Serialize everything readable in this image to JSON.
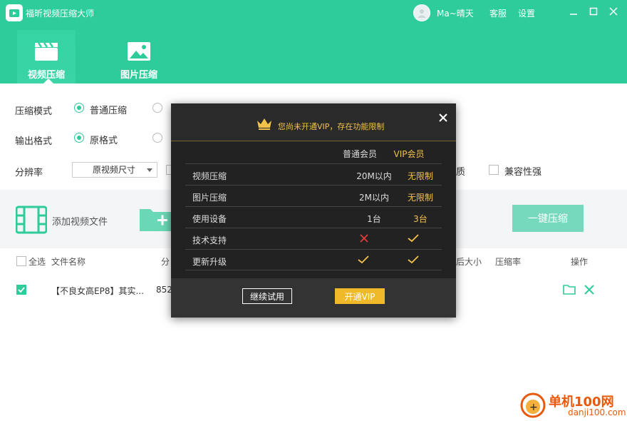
{
  "app": {
    "title": "福昕视频压缩大师"
  },
  "user": {
    "name": "Ma~晴天"
  },
  "header": {
    "service": "客服",
    "settings": "设置"
  },
  "tabs": [
    {
      "label": "视频压缩",
      "active": true
    },
    {
      "label": "图片压缩",
      "active": false
    }
  ],
  "options": {
    "mode_label": "压缩模式",
    "mode_selected": "普通压缩",
    "format_label": "输出格式",
    "format_selected": "原格式",
    "resolution_label": "分辨率",
    "resolution_value": "原视频尺寸",
    "right_option_1": "质",
    "compat_label": "兼容性强"
  },
  "toolbar": {
    "add_video_label": "添加视频文件",
    "compress_button": "一键压缩"
  },
  "table": {
    "headers": {
      "select_all": "全选",
      "file_name": "文件名称",
      "resolution_partial": "分",
      "size_after_partial": "后大小",
      "ratio": "压缩率",
      "action": "操作"
    },
    "rows": [
      {
        "checked": true,
        "name": "【不良女高EP8】其实...",
        "size_partial": "852"
      }
    ]
  },
  "dialog": {
    "title": "您尚未开通VIP，存在功能限制",
    "col_normal": "普通会员",
    "col_vip": "VIP会员",
    "rows": [
      {
        "feature": "视频压缩",
        "normal": "20M以内",
        "vip": "无限制"
      },
      {
        "feature": "图片压缩",
        "normal": "2M以内",
        "vip": "无限制"
      },
      {
        "feature": "使用设备",
        "normal": "1台",
        "vip": "3台"
      },
      {
        "feature": "技术支持",
        "normal_icon": "cross-icon",
        "vip_icon": "check-icon"
      },
      {
        "feature": "更新升级",
        "normal_icon": "check-icon",
        "vip_icon": "check-icon"
      }
    ],
    "trial_button": "继续试用",
    "vip_button": "开通VIP"
  },
  "watermark": {
    "brand": "单机100网",
    "url": "danji100.com"
  },
  "colors": {
    "accent": "#2ecb9b",
    "gold": "#f2c14a",
    "dialog_bg": "#2a2a2a"
  }
}
